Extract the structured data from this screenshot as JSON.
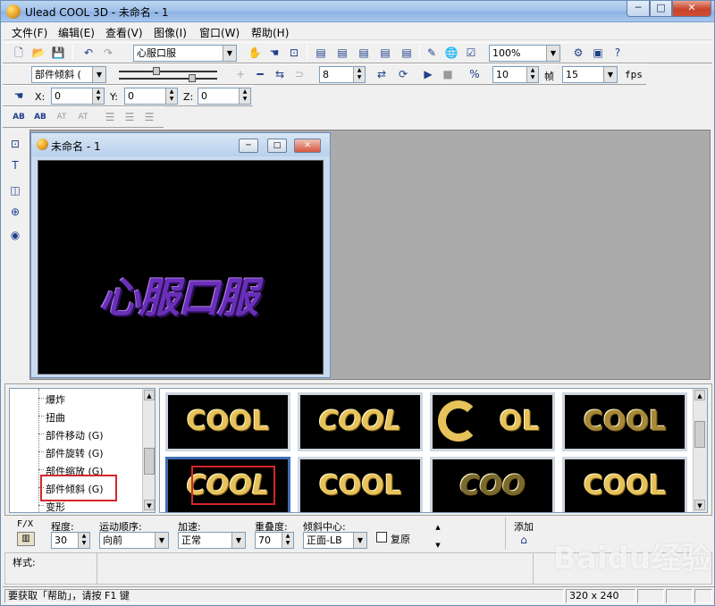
{
  "window": {
    "title": "Ulead COOL 3D - 未命名 - 1",
    "min": "─",
    "max": "□",
    "close": "✕"
  },
  "menu": [
    "文件(F)",
    "编辑(E)",
    "查看(V)",
    "图像(I)",
    "窗口(W)",
    "帮助(H)"
  ],
  "toolbar1": {
    "text_value": "心服口服",
    "zoom_value": "100%"
  },
  "toolbar2": {
    "effect_select": "部件倾斜 (",
    "frames_value": "8",
    "time_value": "10",
    "frame_label": "帧",
    "fps_value": "15",
    "fps_label": "fps"
  },
  "toolbar3": {
    "x_label": "X:",
    "x_value": "0",
    "y_label": "Y:",
    "y_value": "0",
    "z_label": "Z:",
    "z_value": "0"
  },
  "toolbar4": {
    "labels": [
      "AB",
      "AB",
      "AT",
      "AT"
    ]
  },
  "child": {
    "title": "未命名 - 1",
    "min": "─",
    "max": "□",
    "close": "✕"
  },
  "canvas_text": "心服口服",
  "tree": {
    "items": [
      "爆炸",
      "扭曲",
      "部件移动 (G)",
      "部件旋转 (G)",
      "部件缩放 (G)",
      "部件倾斜 (G)",
      "变形"
    ]
  },
  "gallery": {
    "thumbs": [
      "COOL",
      "COOL",
      "OL",
      "COOL",
      "COOL",
      "COOL",
      "COO",
      "COOL"
    ]
  },
  "props": {
    "fx_label": "F/X",
    "degree_label": "程度:",
    "degree_value": "30",
    "order_label": "运动顺序:",
    "order_value": "向前",
    "accel_label": "加速:",
    "accel_value": "正常",
    "overlap_label": "重叠度:",
    "overlap_value": "70",
    "center_label": "倾斜中心:",
    "center_value": "正面-LB",
    "restore_label": "复原",
    "add_label": "添加"
  },
  "style": {
    "label": "样式:"
  },
  "status": {
    "help": "要获取「帮助」，请按 F1 键",
    "size": "320 x 240"
  },
  "watermark": "Baidu经验"
}
